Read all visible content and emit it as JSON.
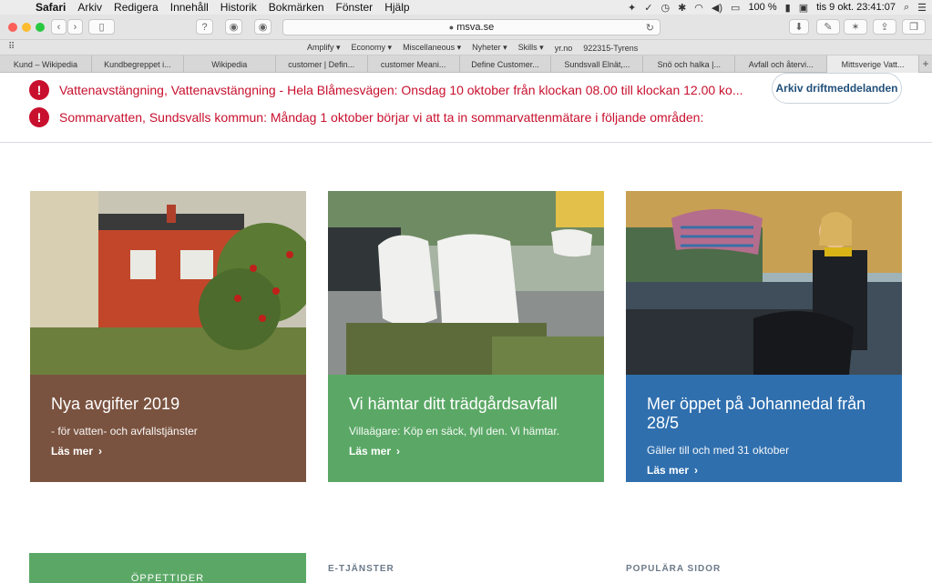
{
  "menubar": {
    "app": "Safari",
    "items": [
      "Arkiv",
      "Redigera",
      "Innehåll",
      "Historik",
      "Bokmärken",
      "Fönster",
      "Hjälp"
    ],
    "battery": "100 %",
    "clock": "tis 9 okt.  23:41:07"
  },
  "toolbar": {
    "url": "msva.se"
  },
  "favorites": [
    "Amplify ▾",
    "Economy ▾",
    "Miscellaneous ▾",
    "Nyheter ▾",
    "Skills ▾",
    "yr.no",
    "922315-Tyrens"
  ],
  "tabs": [
    "Kund – Wikipedia",
    "Kundbegreppet i...",
    "Wikipedia",
    "customer | Defin...",
    "customer Meani...",
    "Define Customer...",
    "Sundsvall Elnät,...",
    "Snö och halka |...",
    "Avfall och återvi...",
    "Mittsverige Vatt..."
  ],
  "alerts": [
    {
      "icon": "!",
      "text": "Vattenavstängning, Vattenavstängning - Hela Blåmesvägen: Onsdag 10 oktober från klockan 08.00 till klockan 12.00 ko..."
    },
    {
      "icon": "!",
      "text": "Sommarvatten, Sundsvalls kommun: Måndag 1 oktober börjar vi att ta in sommarvattenmätare i följande områden:"
    }
  ],
  "archive_button": "Arkiv driftmeddelanden",
  "cards": [
    {
      "title": "Nya avgifter 2019",
      "subtitle": "- för vatten- och avfallstjänster",
      "link": "Läs mer",
      "color": "#7a5340"
    },
    {
      "title": "Vi hämtar ditt trädgårdsavfall",
      "subtitle": "Villaägare: Köp en säck, fyll den. Vi hämtar.",
      "link": "Läs mer",
      "color": "#5ba866"
    },
    {
      "title": "Mer öppet på Johannedal från 28/5",
      "subtitle": "Gäller till och med 31 oktober",
      "link": "Läs mer",
      "color": "#2f6fae"
    }
  ],
  "bottom": {
    "opening_hours": "ÖPPETTIDER",
    "eservices": "E-TJÄNSTER",
    "popular": "POPULÄRA SIDOR"
  }
}
